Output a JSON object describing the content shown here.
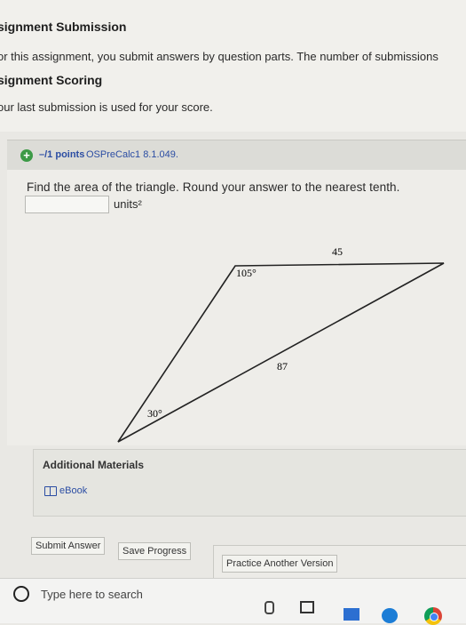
{
  "assignment": {
    "submission_heading": "signment Submission",
    "submission_text": "or this assignment, you submit answers by question parts. The number of submissions",
    "scoring_heading": "signment Scoring",
    "scoring_text": "our last submission is used for your score."
  },
  "question": {
    "points": "–/1 points",
    "source_id": "OSPreCalc1 8.1.049.",
    "prompt": "Find the area of the triangle. Round your answer to the nearest tenth.",
    "answer_value": "",
    "units_label": "units²",
    "figure": {
      "angle_top": "105°",
      "angle_bottom": "30°",
      "side_top": "45",
      "side_right": "87"
    }
  },
  "additional_materials": {
    "title": "Additional Materials",
    "ebook_label": "eBook"
  },
  "buttons": {
    "submit": "Submit Answer",
    "save": "Save Progress",
    "practice": "Practice Another Version"
  },
  "taskbar": {
    "search_placeholder": "Type here to search",
    "icons": [
      "search-circle-icon",
      "microphone-icon",
      "task-view-icon",
      "file-explorer-icon",
      "edge-browser-icon",
      "chrome-icon"
    ]
  },
  "colors": {
    "link_blue": "#2b4da3",
    "status_green": "#3c9a46"
  }
}
